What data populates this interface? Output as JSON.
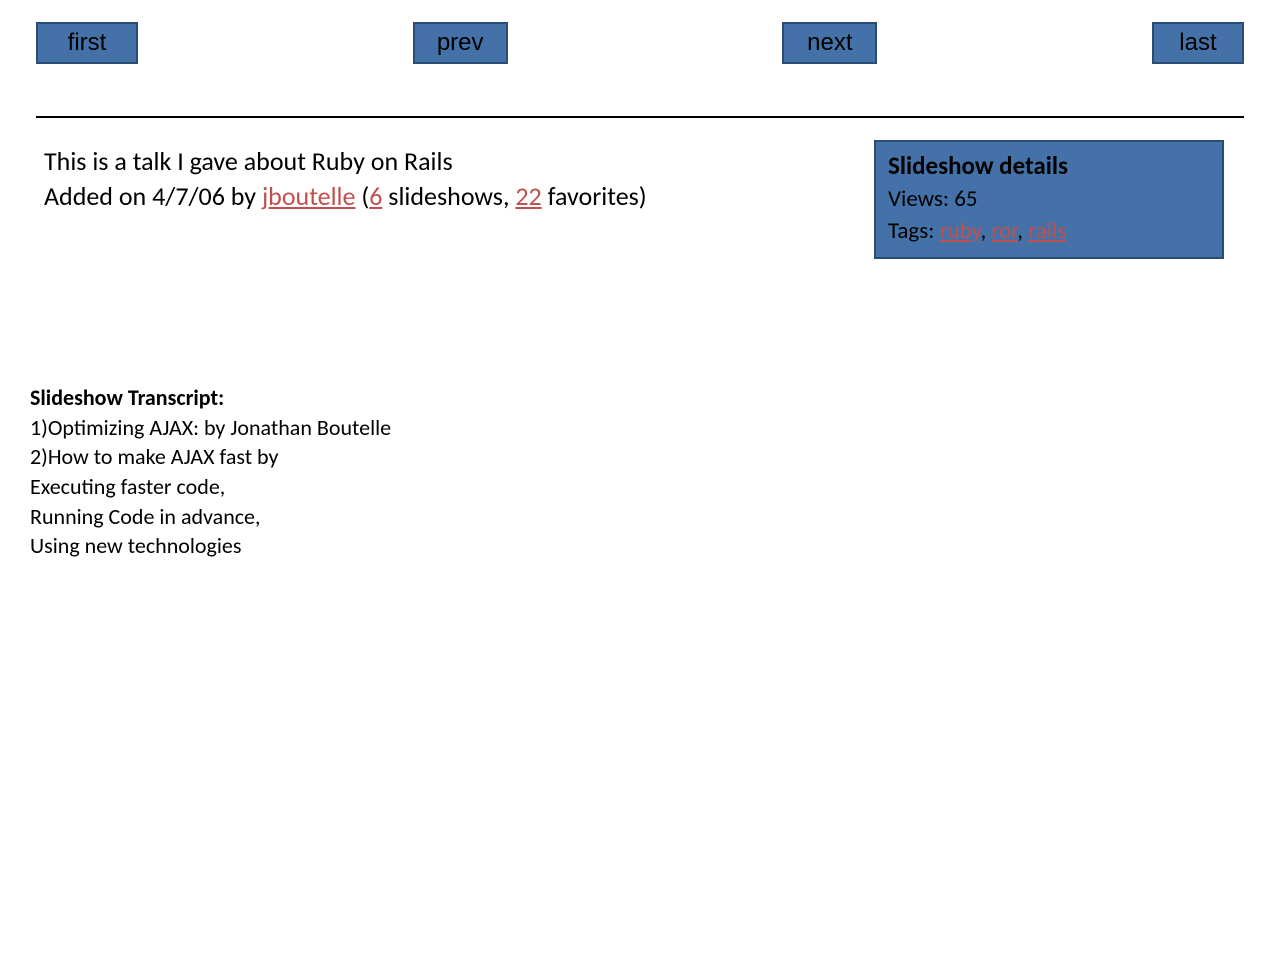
{
  "nav": {
    "first": "first",
    "prev": "prev",
    "next": "next",
    "last": "last"
  },
  "description": {
    "line1": "This is a talk I gave about Ruby on Rails",
    "added_prefix": "Added on ",
    "added_date": "4/7/06",
    "by_text": " by ",
    "user_link": "jboutelle",
    "open_paren": " (",
    "slideshows_count": "6",
    "slideshows_text": " slideshows, ",
    "favorites_count": "22",
    "favorites_text": " favorites)"
  },
  "details": {
    "title": "Slideshow details",
    "views_label": "Views: ",
    "views_count": "65",
    "tags_label": "Tags: ",
    "tag1": "ruby",
    "sep": ", ",
    "tag2": "ror",
    "tag3": "rails"
  },
  "transcript": {
    "title": "Slideshow Transcript:",
    "line1": "1)Optimizing AJAX: by Jonathan Boutelle",
    "line2": "2)How to make AJAX fast by",
    "line3": "Executing faster code,",
    "line4": "Running Code in advance,",
    "line5": "Using new technologies"
  }
}
